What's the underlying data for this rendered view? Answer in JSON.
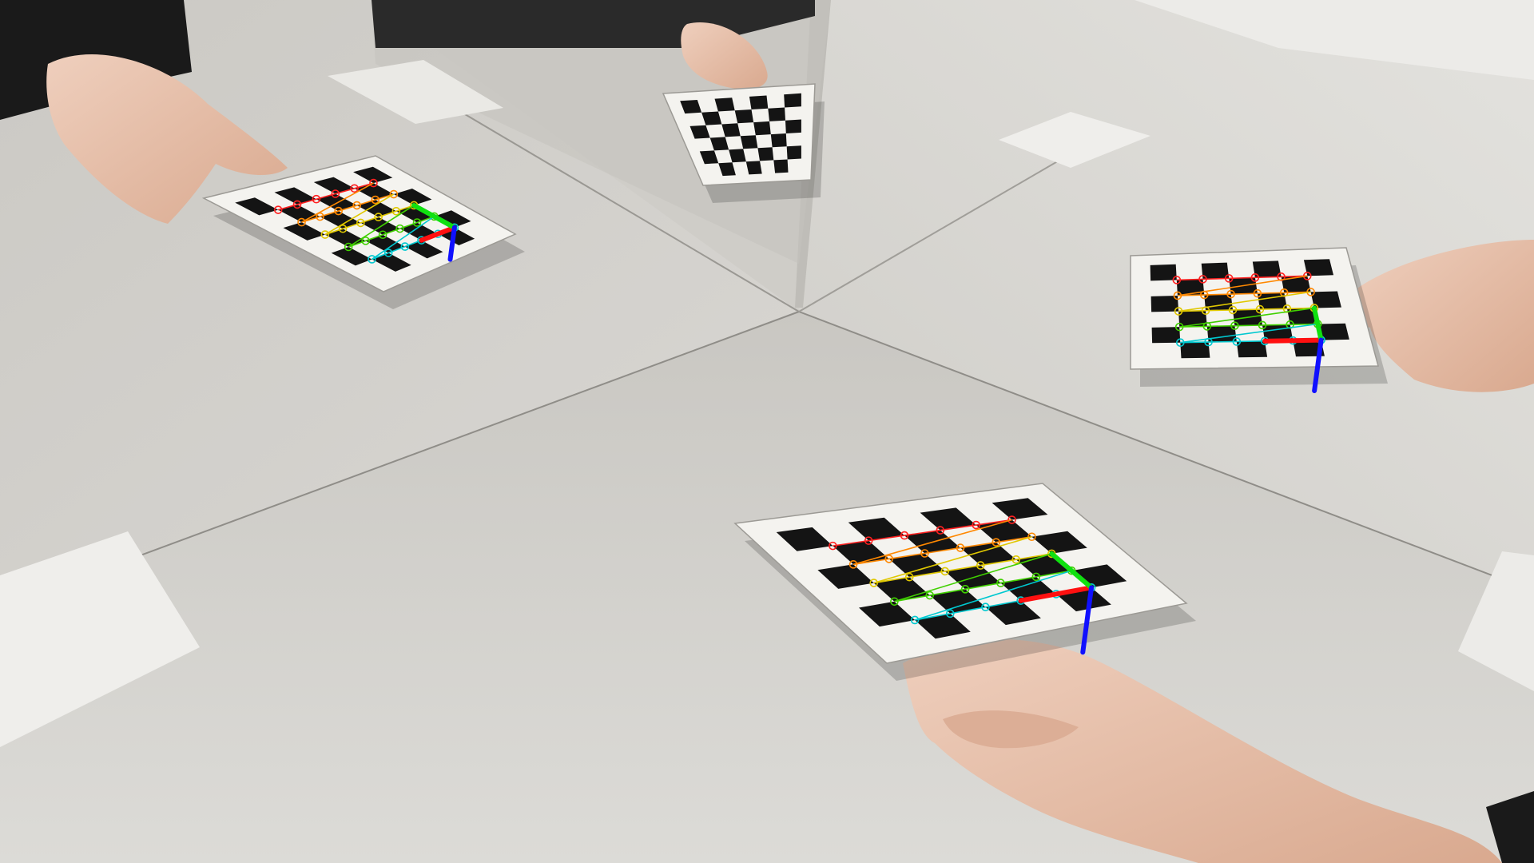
{
  "scene": {
    "description_free": true,
    "overlay_colors": {
      "axis_x": "#ff1010",
      "axis_y": "#10e010",
      "axis_z": "#1010ff",
      "corner_rows": [
        "#ff2020",
        "#ff8800",
        "#e0c800",
        "#40d000",
        "#00c8d0",
        "#20a0ff"
      ]
    },
    "colors": {
      "table": "#d9d8d4",
      "mirror_left": "#cfcdc9",
      "mirror_right": "#d5d3cf",
      "wall": "#e6e5e2",
      "board_paper": "#f4f3ef",
      "board_square": "#141414",
      "skin": "#e9c4b0",
      "sleeve": "#1a1a1a"
    },
    "boards": [
      {
        "id": "board-front",
        "cols": 7,
        "rows": 6,
        "detected": true
      },
      {
        "id": "board-left-reflection",
        "cols": 7,
        "rows": 6,
        "detected": true
      },
      {
        "id": "board-right-reflection",
        "cols": 7,
        "rows": 6,
        "detected": true
      },
      {
        "id": "board-back-reflection",
        "cols": 7,
        "rows": 6,
        "detected": false
      }
    ]
  }
}
